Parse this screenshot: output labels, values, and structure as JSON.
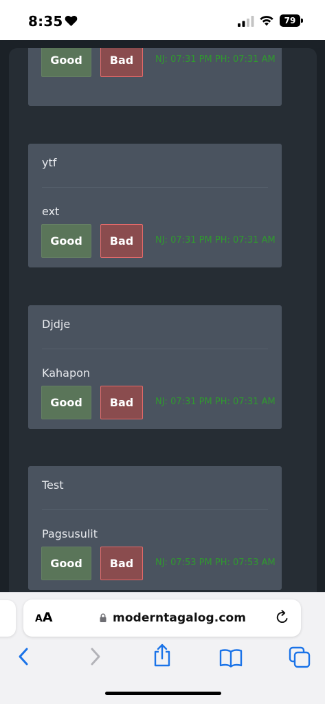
{
  "status_bar": {
    "time": "8:35",
    "battery": "79"
  },
  "cards": [
    {
      "title": "",
      "subtitle": "",
      "good_label": "Good",
      "bad_label": "Bad",
      "timestamp": "NJ: 07:31 PM PH: 07:31 AM"
    },
    {
      "title": "ytf",
      "subtitle": "ext",
      "good_label": "Good",
      "bad_label": "Bad",
      "timestamp": "NJ: 07:31 PM PH: 07:31 AM"
    },
    {
      "title": "Djdje",
      "subtitle": "Kahapon",
      "good_label": "Good",
      "bad_label": "Bad",
      "timestamp": "NJ: 07:31 PM PH: 07:31 AM"
    },
    {
      "title": "Test",
      "subtitle": "Pagsusulit",
      "good_label": "Good",
      "bad_label": "Bad",
      "timestamp": "NJ: 07:53 PM PH: 07:53 AM"
    }
  ],
  "browser": {
    "aa_small": "A",
    "aa_large": "A",
    "url": "moderntagalog.com"
  },
  "colors": {
    "good_button": "#5a7559",
    "bad_button": "#8a4c4e",
    "timestamp": "#2f9a2e",
    "ios_blue": "#1a73e8"
  },
  "icons": [
    "heart-icon",
    "signal-icon",
    "wifi-icon",
    "battery-icon",
    "lock-icon",
    "reload-icon",
    "back-icon",
    "forward-icon",
    "share-icon",
    "bookmarks-icon",
    "tabs-icon"
  ]
}
